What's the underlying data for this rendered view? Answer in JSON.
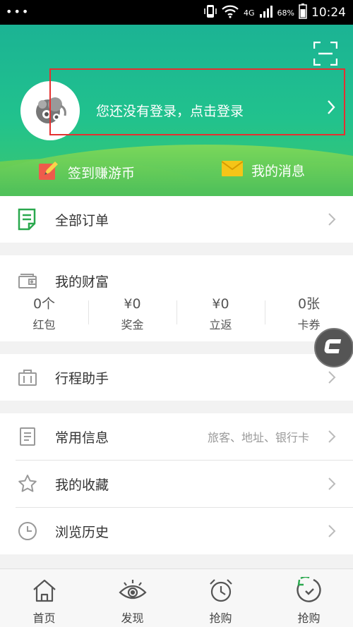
{
  "status_bar": {
    "network": "4G",
    "battery": "68%",
    "time": "10:24"
  },
  "header": {
    "login_prompt": "您还没有登录，点击登录",
    "checkin_label": "签到赚游币",
    "messages_label": "我的消息"
  },
  "orders": {
    "label": "全部订单"
  },
  "wealth": {
    "title": "我的财富",
    "stats": [
      {
        "value": "0个",
        "label": "红包"
      },
      {
        "value": "¥0",
        "label": "奖金"
      },
      {
        "value": "¥0",
        "label": "立返"
      },
      {
        "value": "0张",
        "label": "卡券"
      }
    ]
  },
  "itinerary": {
    "label": "行程助手"
  },
  "common_info": {
    "label": "常用信息",
    "hint": "旅客、地址、银行卡"
  },
  "favorites": {
    "label": "我的收藏"
  },
  "history": {
    "label": "浏览历史"
  },
  "bottom_nav": [
    {
      "label": "首页",
      "icon": "home-icon"
    },
    {
      "label": "发现",
      "icon": "eye-icon"
    },
    {
      "label": "抢购",
      "icon": "alarm-clock-icon"
    },
    {
      "label": "抢购",
      "icon": "refresh-clock-icon"
    }
  ],
  "colors": {
    "brand_green": "#1bb394",
    "highlight_red": "#e53030",
    "orders_icon_green": "#2aa84e",
    "message_icon_yellow": "#f5c518",
    "checkin_icon_red": "#ef5b4b"
  }
}
